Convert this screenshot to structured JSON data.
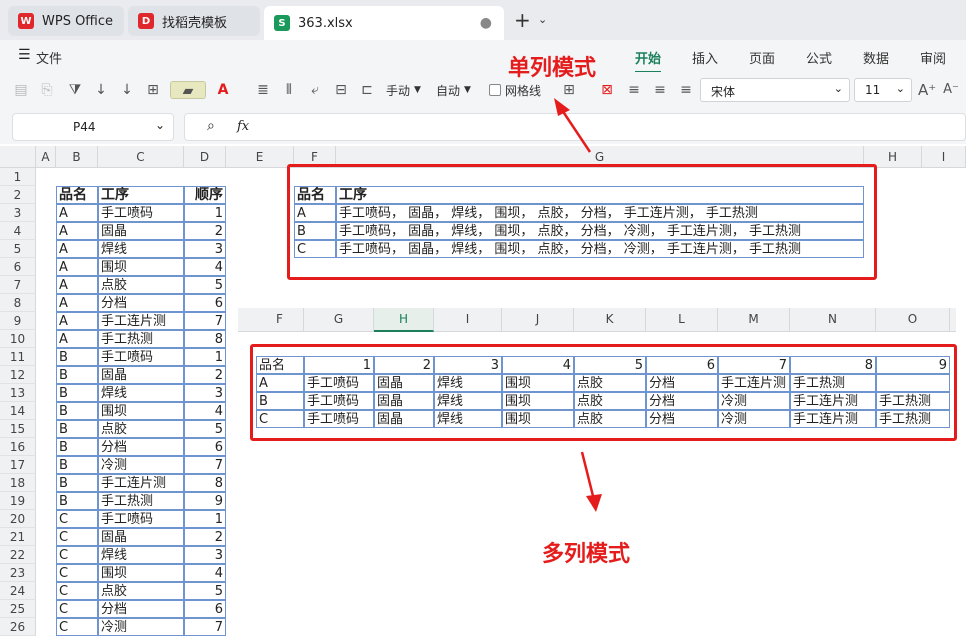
{
  "tabs": {
    "t1": "WPS Office",
    "t2": "找稻壳模板",
    "t3": "363.xlsx"
  },
  "menu": {
    "file": "文件",
    "start": "开始",
    "insert": "插入",
    "page": "页面",
    "formula": "公式",
    "data": "数据",
    "review": "审阅"
  },
  "toolbar": {
    "manual": "手动",
    "auto": "自动",
    "gridlines": "网格线",
    "font": "宋体",
    "size": "11"
  },
  "formula_bar": {
    "cell_ref": "P44",
    "fx": "fx"
  },
  "columns_top": [
    "A",
    "B",
    "C",
    "D",
    "E",
    "F",
    "G",
    "H",
    "I"
  ],
  "rows": [
    "1",
    "2",
    "3",
    "4",
    "5",
    "6",
    "7",
    "8",
    "9",
    "10",
    "11",
    "12",
    "13",
    "14",
    "15",
    "16",
    "17",
    "18",
    "19",
    "20",
    "21",
    "22",
    "23",
    "24",
    "25",
    "26"
  ],
  "left_table": {
    "headers": [
      "品名",
      "工序",
      "顺序"
    ],
    "rows": [
      [
        "A",
        "手工喷码",
        "1"
      ],
      [
        "A",
        "固晶",
        "2"
      ],
      [
        "A",
        "焊线",
        "3"
      ],
      [
        "A",
        "围坝",
        "4"
      ],
      [
        "A",
        "点胶",
        "5"
      ],
      [
        "A",
        "分档",
        "6"
      ],
      [
        "A",
        "手工连片测",
        "7"
      ],
      [
        "A",
        "手工热测",
        "8"
      ],
      [
        "B",
        "手工喷码",
        "1"
      ],
      [
        "B",
        "固晶",
        "2"
      ],
      [
        "B",
        "焊线",
        "3"
      ],
      [
        "B",
        "围坝",
        "4"
      ],
      [
        "B",
        "点胶",
        "5"
      ],
      [
        "B",
        "分档",
        "6"
      ],
      [
        "B",
        "冷测",
        "7"
      ],
      [
        "B",
        "手工连片测",
        "8"
      ],
      [
        "B",
        "手工热测",
        "9"
      ],
      [
        "C",
        "手工喷码",
        "1"
      ],
      [
        "C",
        "固晶",
        "2"
      ],
      [
        "C",
        "焊线",
        "3"
      ],
      [
        "C",
        "围坝",
        "4"
      ],
      [
        "C",
        "点胶",
        "5"
      ],
      [
        "C",
        "分档",
        "6"
      ],
      [
        "C",
        "冷测",
        "7"
      ]
    ]
  },
  "single_table": {
    "headers": [
      "品名",
      "工序"
    ],
    "rows": [
      [
        "A",
        "手工喷码， 固晶， 焊线， 围坝， 点胶， 分档， 手工连片测， 手工热测"
      ],
      [
        "B",
        "手工喷码， 固晶， 焊线， 围坝， 点胶， 分档， 冷测， 手工连片测， 手工热测"
      ],
      [
        "C",
        "手工喷码， 固晶， 焊线， 围坝， 点胶， 分档， 冷测， 手工连片测， 手工热测"
      ]
    ]
  },
  "columns_mid": [
    "F",
    "G",
    "H",
    "I",
    "J",
    "K",
    "L",
    "M",
    "N",
    "O"
  ],
  "multi_table": {
    "headers": [
      "品名",
      "1",
      "2",
      "3",
      "4",
      "5",
      "6",
      "7",
      "8",
      "9"
    ],
    "rows": [
      [
        "A",
        "手工喷码",
        "固晶",
        "焊线",
        "围坝",
        "点胶",
        "分档",
        "手工连片测",
        "手工热测",
        ""
      ],
      [
        "B",
        "手工喷码",
        "固晶",
        "焊线",
        "围坝",
        "点胶",
        "分档",
        "冷测",
        "手工连片测",
        "手工热测"
      ],
      [
        "C",
        "手工喷码",
        "固晶",
        "焊线",
        "围坝",
        "点胶",
        "分档",
        "冷测",
        "手工连片测",
        "手工热测"
      ]
    ]
  },
  "annotations": {
    "single": "单列模式",
    "multi": "多列模式"
  },
  "colors": {
    "accent": "#1a7f5a",
    "red": "#e51c1c"
  }
}
